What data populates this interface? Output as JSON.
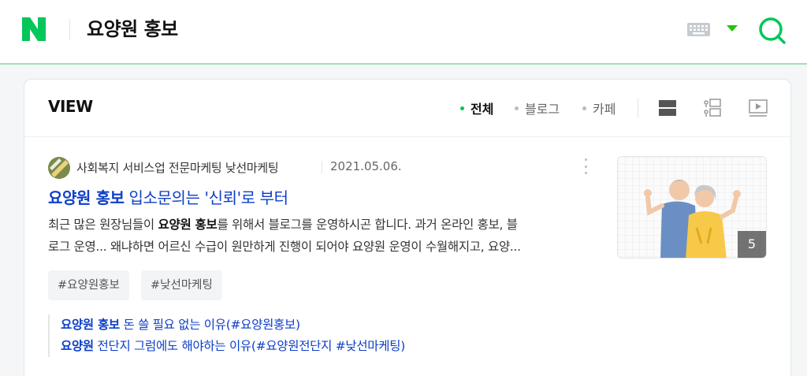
{
  "header": {
    "logo_letter": "N",
    "query": "요양원 홍보",
    "brand_color": "#03c75a"
  },
  "view": {
    "title": "VIEW",
    "filters": [
      {
        "label": "전체",
        "active": true
      },
      {
        "label": "블로그",
        "active": false
      },
      {
        "label": "카페",
        "active": false
      }
    ]
  },
  "post": {
    "blog_name": "사회복지 서비스업 전문마케팅 낮선마케팅",
    "date": "2021.05.06.",
    "title_highlight": "요양원 홍보",
    "title_rest": " 입소문의는 '신뢰'로 부터",
    "desc_line1_pre": "최근 많은 원장님들이 ",
    "desc_line1_bold": "요양원 홍보",
    "desc_line1_post": "를 위해서 블로그를 운영하시곤 합니다. 과거 온라인 홍보, 블",
    "desc_line2": "로그 운영... 왜냐하면 어르신 수급이 원만하게 진행이 되어야 요양원 운영이 수월해지고, 요양...",
    "tags": [
      "#요양원홍보",
      "#낮선마케팅"
    ],
    "thumbnail_count": "5",
    "related": [
      {
        "highlight": "요양원 홍보",
        "rest": " 돈 쓸 필요 없는 이유(#요양원홍보)"
      },
      {
        "highlight": "요양원",
        "rest": " 전단지 그럼에도 해야하는 이유(#요양원전단지 #낮선마케팅)"
      }
    ]
  }
}
